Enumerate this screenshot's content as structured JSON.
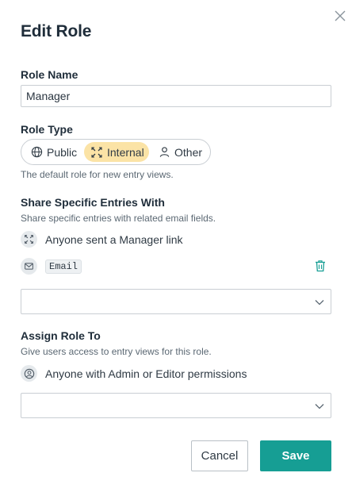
{
  "dialog": {
    "title": "Edit Role",
    "close_icon": "close-icon"
  },
  "role_name": {
    "label": "Role Name",
    "value": "Manager"
  },
  "role_type": {
    "label": "Role Type",
    "options": [
      {
        "label": "Public",
        "icon": "globe-icon",
        "selected": false
      },
      {
        "label": "Internal",
        "icon": "internal-link-icon",
        "selected": true
      },
      {
        "label": "Other",
        "icon": "person-icon",
        "selected": false
      }
    ],
    "help": "The default role for new entry views."
  },
  "share": {
    "label": "Share Specific Entries With",
    "help": "Share specific entries with related email fields.",
    "link_text": "Anyone sent a Manager link",
    "link_icon": "internal-link-icon",
    "email_tag": "Email",
    "email_icon": "envelope-icon",
    "delete_icon": "trash-icon",
    "select_value": ""
  },
  "assign": {
    "label": "Assign Role To",
    "help": "Give users access to entry views for this role.",
    "permission_text": "Anyone with Admin or Editor permissions",
    "permission_icon": "user-circle-icon",
    "select_value": ""
  },
  "actions": {
    "cancel_label": "Cancel",
    "save_label": "Save"
  },
  "colors": {
    "accent": "#169e94",
    "selected_option": "#fbe3a6",
    "title_text": "#1f2d3a"
  }
}
